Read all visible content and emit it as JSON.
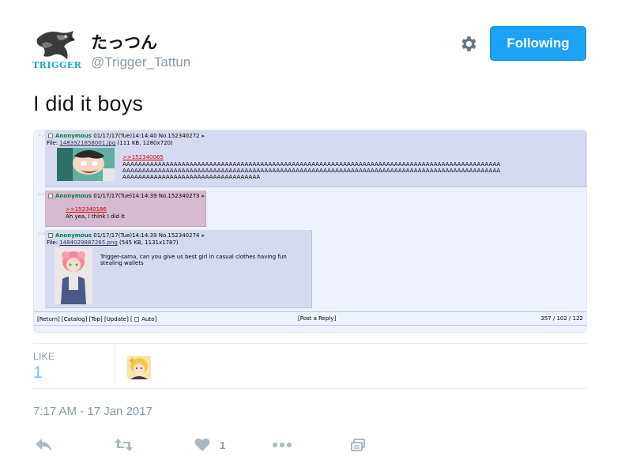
{
  "user": {
    "avatar_text": "TRIGGER",
    "display_name": "たっつん",
    "handle": "@Trigger_Tattun"
  },
  "follow_button": {
    "label": "Following"
  },
  "tweet": {
    "text": "I did it boys"
  },
  "media": {
    "posts": [
      {
        "name": "Anonymous",
        "datetime": "01/17/17(Tue)14:14:40",
        "number": "No.152340272",
        "file_prefix": "File:",
        "file_link": "1483921858001.jpg",
        "file_meta": "(111 KB, 1280x720)",
        "quote": ">>152340065",
        "lines": [
          "AAAAAAAAAAAAAAAAAAAAAAAAAAAAAAAAAAAAAAAAAAAAAAAAAAAAAAAAAAAAAAAAAAAAAAAAAAAAAAAAAAAAAAAAAAAAAAAA",
          "AAAAAAAAAAAAAAAAAAAAAAAAAAAAAAAAAAAAAAAAAAAAAAAAAAAAAAAAAAAAAAAAAAAAAAAAAAAAAAAAAAAAAAAAAAAAAAAA",
          "AAAAAAAAAAAAAAAAAAAAAAAAAAAAAAAAAAA"
        ]
      },
      {
        "name": "Anonymous",
        "datetime": "01/17/17(Tue)14:14:39",
        "number": "No.152340273",
        "quote": ">>152340186",
        "lines": [
          "Ah yea, I think I did it"
        ]
      },
      {
        "name": "Anonymous",
        "datetime": "01/17/17(Tue)14:14:39",
        "number": "No.152340274",
        "file_prefix": "File:",
        "file_link": "1484029887265.png",
        "file_meta": "(545 KB, 1131x1787)",
        "lines": [
          "Trigger-sama, can you give us best girl in casual clothes having fun",
          "stealing wallets"
        ]
      }
    ],
    "footer": {
      "left": "[Return] [Catalog] [Top] [Update] [",
      "auto": "Auto]",
      "center": "[Post a Reply]",
      "right": "357 / 102 / 122"
    }
  },
  "stats": {
    "like_label": "LIKE",
    "like_count": "1"
  },
  "timestamp": "7:17 AM - 17 Jan 2017",
  "actions": {
    "like_count": "1"
  },
  "colors": {
    "accent": "#1da1f2",
    "muted": "#8899a6",
    "post_bg": "#d6daf0",
    "highlight_bg": "#d6bad0"
  }
}
